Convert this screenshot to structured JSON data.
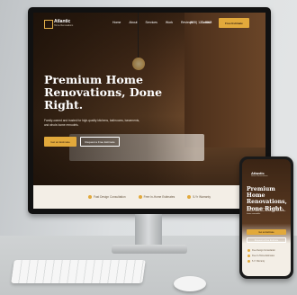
{
  "brand": {
    "name": "Atlantic",
    "tagline": "Home Renovations"
  },
  "nav": {
    "items": [
      "Home",
      "About",
      "Services",
      "Work",
      "Reviews",
      "Contact"
    ],
    "phone": "(555) 123-4567",
    "cta": "Free Estimate"
  },
  "hero": {
    "title": "Premium Home Renovations, Done Right.",
    "subtitle": "Family-owned and trusted for high-quality kitchens, bathrooms, basements, and whole-home remodels.",
    "primary_button": "Get an Estimate",
    "secondary_button": "Request a Free Estimate"
  },
  "trust": [
    "Fast Design Consultation",
    "Free In-Home Estimates",
    "5-Yr Warranty"
  ],
  "mobile": {
    "title": "Premium Home Renovations, Done Right.",
    "primary_button": "Get an Estimate",
    "secondary_button": "Request a Free Estimate",
    "trust": [
      "Free Design Consultation",
      "Free In-Home Estimates",
      "5-Yr Warranty"
    ]
  },
  "colors": {
    "accent": "#e2a93b",
    "dark": "#2b1a10",
    "cream": "#f3eee6"
  }
}
